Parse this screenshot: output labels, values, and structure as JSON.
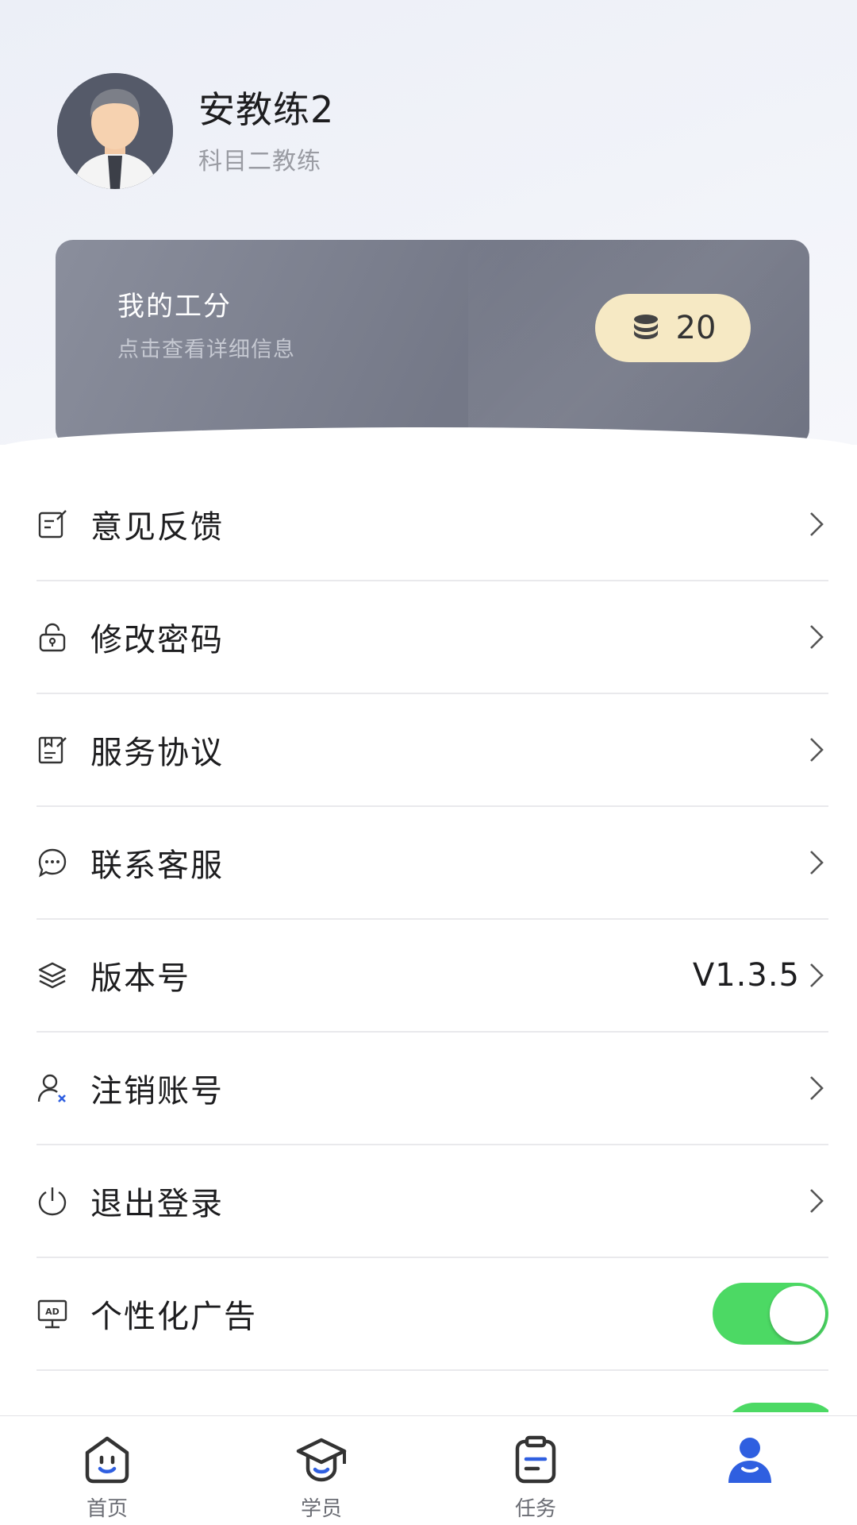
{
  "profile": {
    "name": "安教练2",
    "role": "科目二教练"
  },
  "points": {
    "title": "我的工分",
    "subtitle": "点击查看详细信息",
    "value": "20"
  },
  "menu": [
    {
      "label": "意见反馈",
      "icon": "feedback-edit-icon"
    },
    {
      "label": "修改密码",
      "icon": "lock-icon"
    },
    {
      "label": "服务协议",
      "icon": "document-edit-icon"
    },
    {
      "label": "联系客服",
      "icon": "chat-bubble-icon"
    },
    {
      "label": "版本号",
      "icon": "layers-icon",
      "value": "V1.3.5"
    },
    {
      "label": "注销账号",
      "icon": "user-remove-icon"
    },
    {
      "label": "退出登录",
      "icon": "power-icon"
    },
    {
      "label": "个性化广告",
      "icon": "ad-board-icon",
      "toggle": true
    }
  ],
  "tabbar": [
    {
      "label": "首页",
      "icon": "home-face-icon"
    },
    {
      "label": "学员",
      "icon": "graduation-cap-icon"
    },
    {
      "label": "任务",
      "icon": "clipboard-icon"
    },
    {
      "label": "",
      "icon": "profile-person-icon"
    }
  ],
  "colors": {
    "toggle_on": "#4cd964",
    "points_pill": "#f6e9c4",
    "card": "#777b8a",
    "active_tab": "#2f5fe0"
  }
}
